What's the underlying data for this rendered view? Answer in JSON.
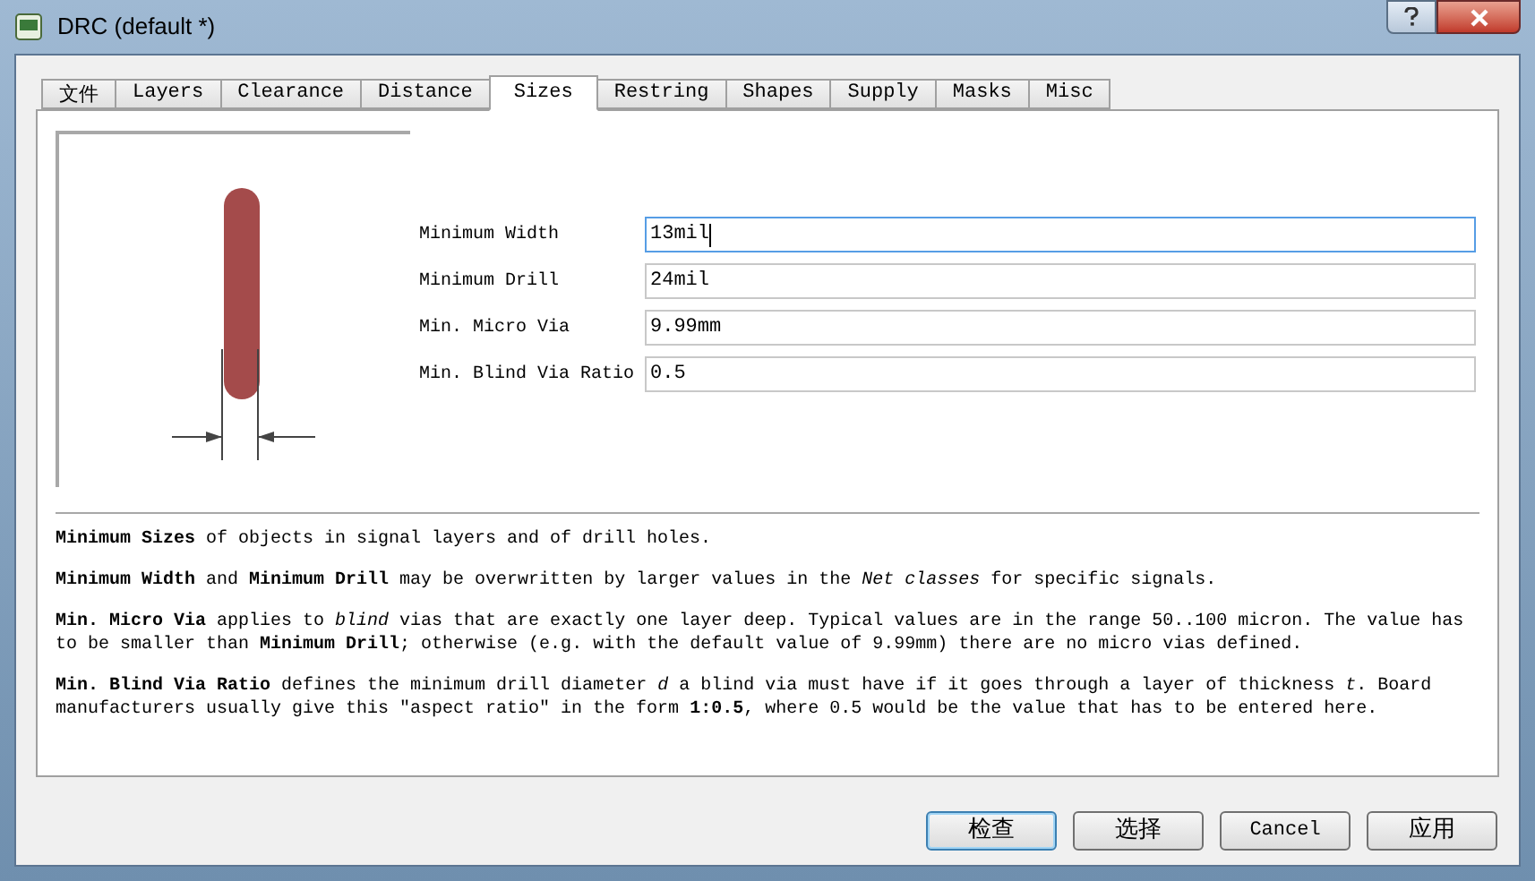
{
  "window": {
    "title": "DRC (default *)"
  },
  "tabs": [
    {
      "label": "文件",
      "selected": false
    },
    {
      "label": "Layers",
      "selected": false
    },
    {
      "label": "Clearance",
      "selected": false
    },
    {
      "label": "Distance",
      "selected": false
    },
    {
      "label": "Sizes",
      "selected": true
    },
    {
      "label": "Restring",
      "selected": false
    },
    {
      "label": "Shapes",
      "selected": false
    },
    {
      "label": "Supply",
      "selected": false
    },
    {
      "label": "Masks",
      "selected": false
    },
    {
      "label": "Misc",
      "selected": false
    }
  ],
  "fields": [
    {
      "label": "Minimum Width",
      "value": "13mil",
      "focused": true
    },
    {
      "label": "Minimum Drill",
      "value": "24mil",
      "focused": false
    },
    {
      "label": "Min. Micro Via",
      "value": "9.99mm",
      "focused": false
    },
    {
      "label": "Min. Blind Via Ratio",
      "value": "0.5",
      "focused": false
    }
  ],
  "help": [
    "**Minimum Sizes** of objects in signal layers and of drill holes.",
    "**Minimum Width** and **Minimum Drill** may be overwritten by larger values in the *Net classes* for specific signals.",
    "**Min. Micro Via** applies to *blind* vias that are exactly one layer deep. Typical values are in the range 50..100 micron. The value has to be smaller than **Minimum Drill**; otherwise (e.g. with the default value of 9.99mm) there are no micro vias defined.",
    "**Min. Blind Via Ratio** defines the minimum drill diameter *d* a blind via must have if it goes through a layer of thickness *t*. Board manufacturers usually give this \"aspect ratio\" in the form **1:0.5**, where 0.5 would be the value that has to be entered here."
  ],
  "buttons": [
    {
      "label": "检查",
      "default": true
    },
    {
      "label": "选择",
      "default": false
    },
    {
      "label": "Cancel",
      "default": false
    },
    {
      "label": "应用",
      "default": false
    }
  ]
}
